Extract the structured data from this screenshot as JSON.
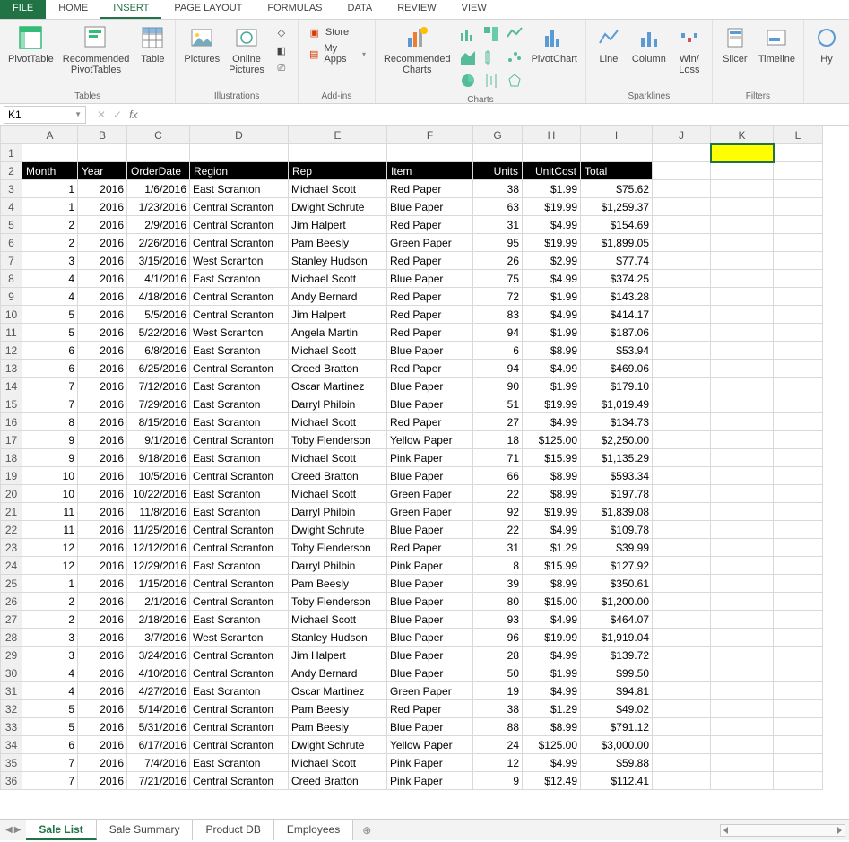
{
  "tabs": {
    "file": "FILE",
    "home": "HOME",
    "insert": "INSERT",
    "pageLayout": "PAGE LAYOUT",
    "formulas": "FORMULAS",
    "data": "DATA",
    "review": "REVIEW",
    "view": "VIEW"
  },
  "ribbon": {
    "tables": {
      "label": "Tables",
      "pivot": "PivotTable",
      "recPivot": "Recommended\nPivotTables",
      "table": "Table"
    },
    "illus": {
      "label": "Illustrations",
      "pictures": "Pictures",
      "online": "Online\nPictures"
    },
    "addins": {
      "label": "Add-ins",
      "store": "Store",
      "myapps": "My Apps"
    },
    "charts": {
      "label": "Charts",
      "rec": "Recommended\nCharts",
      "pivot": "PivotChart"
    },
    "spark": {
      "label": "Sparklines",
      "line": "Line",
      "column": "Column",
      "winloss": "Win/\nLoss"
    },
    "filters": {
      "label": "Filters",
      "slicer": "Slicer",
      "timeline": "Timeline"
    },
    "links": {
      "hy": "Hy"
    }
  },
  "nameBox": "K1",
  "formula": "",
  "columns": [
    "A",
    "B",
    "C",
    "D",
    "E",
    "F",
    "G",
    "H",
    "I",
    "J",
    "K",
    "L"
  ],
  "headers": [
    "Month",
    "Year",
    "OrderDate",
    "Region",
    "Rep",
    "Item",
    "Units",
    "UnitCost",
    "Total"
  ],
  "headerAlignRight": [
    false,
    false,
    false,
    false,
    false,
    false,
    true,
    true,
    false
  ],
  "rows": [
    [
      1,
      2016,
      "1/6/2016",
      "East Scranton",
      "Michael Scott",
      "Red Paper",
      38,
      "$1.99",
      "$75.62"
    ],
    [
      1,
      2016,
      "1/23/2016",
      "Central Scranton",
      "Dwight Schrute",
      "Blue Paper",
      63,
      "$19.99",
      "$1,259.37"
    ],
    [
      2,
      2016,
      "2/9/2016",
      "Central Scranton",
      "Jim Halpert",
      "Red Paper",
      31,
      "$4.99",
      "$154.69"
    ],
    [
      2,
      2016,
      "2/26/2016",
      "Central Scranton",
      "Pam Beesly",
      "Green Paper",
      95,
      "$19.99",
      "$1,899.05"
    ],
    [
      3,
      2016,
      "3/15/2016",
      "West Scranton",
      "Stanley Hudson",
      "Red Paper",
      26,
      "$2.99",
      "$77.74"
    ],
    [
      4,
      2016,
      "4/1/2016",
      "East Scranton",
      "Michael Scott",
      "Blue Paper",
      75,
      "$4.99",
      "$374.25"
    ],
    [
      4,
      2016,
      "4/18/2016",
      "Central Scranton",
      "Andy Bernard",
      "Red Paper",
      72,
      "$1.99",
      "$143.28"
    ],
    [
      5,
      2016,
      "5/5/2016",
      "Central Scranton",
      "Jim Halpert",
      "Red Paper",
      83,
      "$4.99",
      "$414.17"
    ],
    [
      5,
      2016,
      "5/22/2016",
      "West Scranton",
      "Angela Martin",
      "Red Paper",
      94,
      "$1.99",
      "$187.06"
    ],
    [
      6,
      2016,
      "6/8/2016",
      "East Scranton",
      "Michael Scott",
      "Blue Paper",
      6,
      "$8.99",
      "$53.94"
    ],
    [
      6,
      2016,
      "6/25/2016",
      "Central Scranton",
      "Creed Bratton",
      "Red Paper",
      94,
      "$4.99",
      "$469.06"
    ],
    [
      7,
      2016,
      "7/12/2016",
      "East Scranton",
      "Oscar Martinez",
      "Blue Paper",
      90,
      "$1.99",
      "$179.10"
    ],
    [
      7,
      2016,
      "7/29/2016",
      "East Scranton",
      "Darryl Philbin",
      "Blue Paper",
      51,
      "$19.99",
      "$1,019.49"
    ],
    [
      8,
      2016,
      "8/15/2016",
      "East Scranton",
      "Michael Scott",
      "Red Paper",
      27,
      "$4.99",
      "$134.73"
    ],
    [
      9,
      2016,
      "9/1/2016",
      "Central Scranton",
      "Toby Flenderson",
      "Yellow Paper",
      18,
      "$125.00",
      "$2,250.00"
    ],
    [
      9,
      2016,
      "9/18/2016",
      "East Scranton",
      "Michael Scott",
      "Pink Paper",
      71,
      "$15.99",
      "$1,135.29"
    ],
    [
      10,
      2016,
      "10/5/2016",
      "Central Scranton",
      "Creed Bratton",
      "Blue Paper",
      66,
      "$8.99",
      "$593.34"
    ],
    [
      10,
      2016,
      "10/22/2016",
      "East Scranton",
      "Michael Scott",
      "Green Paper",
      22,
      "$8.99",
      "$197.78"
    ],
    [
      11,
      2016,
      "11/8/2016",
      "East Scranton",
      "Darryl Philbin",
      "Green Paper",
      92,
      "$19.99",
      "$1,839.08"
    ],
    [
      11,
      2016,
      "11/25/2016",
      "Central Scranton",
      "Dwight Schrute",
      "Blue Paper",
      22,
      "$4.99",
      "$109.78"
    ],
    [
      12,
      2016,
      "12/12/2016",
      "Central Scranton",
      "Toby Flenderson",
      "Red Paper",
      31,
      "$1.29",
      "$39.99"
    ],
    [
      12,
      2016,
      "12/29/2016",
      "East Scranton",
      "Darryl Philbin",
      "Pink Paper",
      8,
      "$15.99",
      "$127.92"
    ],
    [
      1,
      2016,
      "1/15/2016",
      "Central Scranton",
      "Pam Beesly",
      "Blue Paper",
      39,
      "$8.99",
      "$350.61"
    ],
    [
      2,
      2016,
      "2/1/2016",
      "Central Scranton",
      "Toby Flenderson",
      "Blue Paper",
      80,
      "$15.00",
      "$1,200.00"
    ],
    [
      2,
      2016,
      "2/18/2016",
      "East Scranton",
      "Michael Scott",
      "Blue Paper",
      93,
      "$4.99",
      "$464.07"
    ],
    [
      3,
      2016,
      "3/7/2016",
      "West Scranton",
      "Stanley Hudson",
      "Blue Paper",
      96,
      "$19.99",
      "$1,919.04"
    ],
    [
      3,
      2016,
      "3/24/2016",
      "Central Scranton",
      "Jim Halpert",
      "Blue Paper",
      28,
      "$4.99",
      "$139.72"
    ],
    [
      4,
      2016,
      "4/10/2016",
      "Central Scranton",
      "Andy Bernard",
      "Blue Paper",
      50,
      "$1.99",
      "$99.50"
    ],
    [
      4,
      2016,
      "4/27/2016",
      "East Scranton",
      "Oscar Martinez",
      "Green Paper",
      19,
      "$4.99",
      "$94.81"
    ],
    [
      5,
      2016,
      "5/14/2016",
      "Central Scranton",
      "Pam Beesly",
      "Red Paper",
      38,
      "$1.29",
      "$49.02"
    ],
    [
      5,
      2016,
      "5/31/2016",
      "Central Scranton",
      "Pam Beesly",
      "Blue Paper",
      88,
      "$8.99",
      "$791.12"
    ],
    [
      6,
      2016,
      "6/17/2016",
      "Central Scranton",
      "Dwight Schrute",
      "Yellow Paper",
      24,
      "$125.00",
      "$3,000.00"
    ],
    [
      7,
      2016,
      "7/4/2016",
      "East Scranton",
      "Michael Scott",
      "Pink Paper",
      12,
      "$4.99",
      "$59.88"
    ],
    [
      7,
      2016,
      "7/21/2016",
      "Central Scranton",
      "Creed Bratton",
      "Pink Paper",
      9,
      "$12.49",
      "$112.41"
    ]
  ],
  "numericCols": [
    0,
    1,
    2,
    6,
    7,
    8
  ],
  "selectedCell": "K1",
  "sheets": [
    "Sale List",
    "Sale Summary",
    "Product DB",
    "Employees"
  ],
  "activeSheet": 0
}
